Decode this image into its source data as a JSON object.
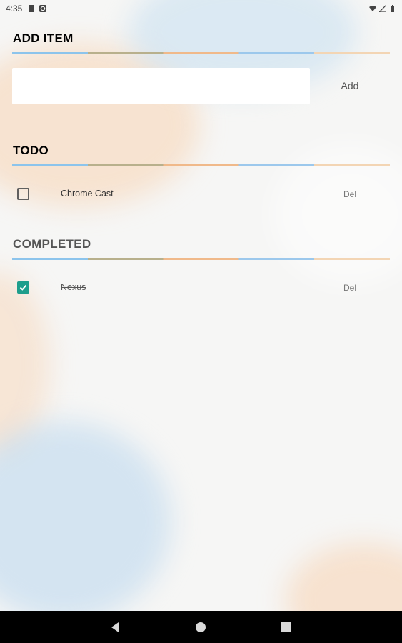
{
  "status_bar": {
    "time": "4:35",
    "left_icons": [
      "sd-card-icon",
      "sync-icon"
    ],
    "right_icons": [
      "wifi-icon",
      "signal-icon",
      "battery-icon"
    ]
  },
  "add_section": {
    "title": "ADD ITEM",
    "input_value": "",
    "input_placeholder": "",
    "add_label": "Add"
  },
  "todo_section": {
    "title": "TODO",
    "items": [
      {
        "label": "Chrome Cast",
        "checked": false,
        "del_label": "Del"
      }
    ]
  },
  "completed_section": {
    "title": "COMPLETED",
    "items": [
      {
        "label": "Nexus",
        "checked": true,
        "del_label": "Del"
      }
    ]
  },
  "nav_bar": {
    "buttons": [
      "back-icon",
      "home-icon",
      "recents-icon"
    ]
  },
  "colors": {
    "accent": "#1e9e8c",
    "divider_segments": [
      "#8cc4ec",
      "#b8b08c",
      "#f0b98a",
      "#9cc8ec",
      "#f3d5b4"
    ]
  }
}
